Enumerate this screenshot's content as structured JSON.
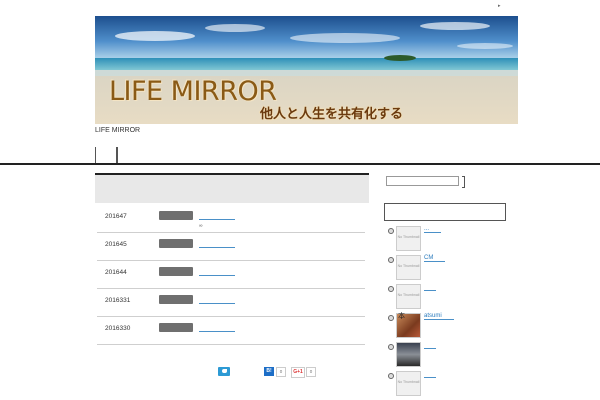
{
  "header": {
    "top_mark": "▸",
    "banner_title": "LIFE MIRROR",
    "banner_tagline": "他人と人生を共有化する",
    "site_name": "LIFE MIRROR",
    "nav_items": [
      "",
      ""
    ]
  },
  "posts": [
    {
      "date": "201647",
      "link": "",
      "note": "∞"
    },
    {
      "date": "201645",
      "link": "",
      "note": ""
    },
    {
      "date": "201644",
      "link": "",
      "note": ""
    },
    {
      "date": "2016331",
      "link": "",
      "note": ""
    },
    {
      "date": "2016330",
      "link": "",
      "note": ""
    }
  ],
  "share": {
    "hatena_label": "B!",
    "hatena_count": "0",
    "gplus_label": "G+1",
    "gplus_count": "0"
  },
  "sidebar": {
    "search_placeholder": "",
    "recent": [
      {
        "thumb": "No Thumbnail",
        "title": "..."
      },
      {
        "thumb": "No Thumbnail",
        "title": "CM"
      },
      {
        "thumb": "No Thumbnail",
        "title": ""
      },
      {
        "thumb": "本",
        "title": "atsumi"
      },
      {
        "thumb": "",
        "title": ""
      },
      {
        "thumb": "No Thumbnail",
        "title": ""
      }
    ]
  }
}
